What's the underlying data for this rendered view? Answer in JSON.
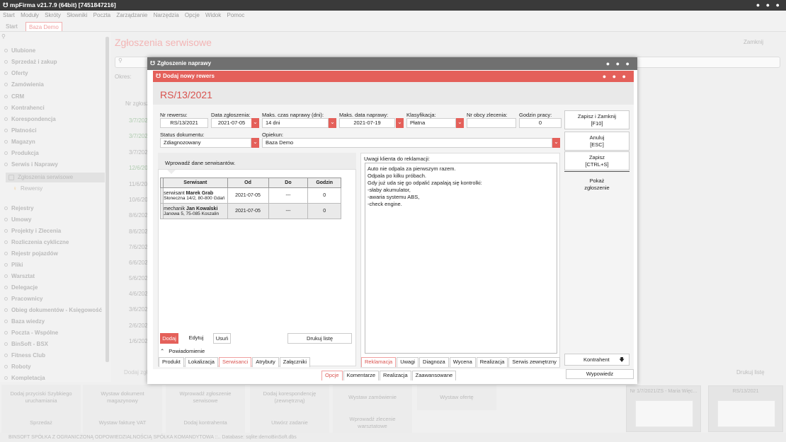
{
  "app": {
    "title": "mpFirma v21.7.9 (64bit) [7451847216]"
  },
  "menu": [
    "Start",
    "Moduły",
    "Skróty",
    "Słowniki",
    "Poczta",
    "Zarządzanie",
    "Narzędzia",
    "Opcje",
    "Widok",
    "Pomoc"
  ],
  "top_tabs": [
    "Start",
    "Baza Demo"
  ],
  "sidebar": {
    "items": [
      {
        "label": "Ulubione"
      },
      {
        "label": "Sprzedaż i zakup"
      },
      {
        "label": "Oferty"
      },
      {
        "label": "Zamówienia"
      },
      {
        "label": "CRM"
      },
      {
        "label": "Kontrahenci"
      },
      {
        "label": "Korespondencja"
      },
      {
        "label": "Płatności"
      },
      {
        "label": "Magazyn"
      },
      {
        "label": "Produkcja"
      },
      {
        "label": "Serwis i Naprawy"
      },
      {
        "label": "Zgłoszenia serwisowe"
      },
      {
        "label": "Rewersy"
      },
      {
        "label": "Rejestry"
      },
      {
        "label": "Umowy"
      },
      {
        "label": "Projekty i Zlecenia"
      },
      {
        "label": "Rozliczenia cykliczne"
      },
      {
        "label": "Rejestr pojazdów"
      },
      {
        "label": "Pliki"
      },
      {
        "label": "Warsztat"
      },
      {
        "label": "Delegacje"
      },
      {
        "label": "Pracownicy"
      },
      {
        "label": "Obieg dokumentów - Księgowość"
      },
      {
        "label": "Baza wiedzy"
      },
      {
        "label": "Poczta - Wspólne"
      },
      {
        "label": "BinSoft - BSX"
      },
      {
        "label": "Fitness Club"
      },
      {
        "label": "Roboty"
      },
      {
        "label": "Kompletacja"
      }
    ]
  },
  "background": {
    "title": "Zgłoszenia serwisowe",
    "close": "Zamknij",
    "okres": "Okres:",
    "col_nr": "Nr zgłosz",
    "dates": [
      "3/7/202",
      "3/7/202",
      "3/7/202",
      "12/6/202",
      "11/6/202",
      "10/6/202",
      "8/6/202",
      "8/6/202",
      "7/6/202",
      "6/6/202",
      "5/6/202",
      "4/6/202",
      "3/6/202",
      "2/6/202",
      "1/6/202"
    ],
    "dodaj": "Dodaj zgł",
    "drukuj": "Drukuj listę",
    "wypowiedz": "Wypowiedz"
  },
  "tiles": [
    "Dodaj przyciski Szybkiego uruchamiania",
    "Wystaw dokument magazynowy",
    "Wprowadź zgłoszenie serwisowe",
    "Dodaj korespondencję (zewnętrzną)",
    "Wystaw zamówienie",
    "Wystaw ofertę",
    "Sprzedaż",
    "Wystaw fakturę VAT",
    "Dodaj kontrahenta",
    "Utwórz zadanie",
    "Wprowadź zlecenie warsztatowe"
  ],
  "thumbs": [
    "Nr 1/7/2021/ZS - Maria Więc...",
    "RS/13/2021"
  ],
  "statusbar": "BINSOFT SPÓŁKA Z OGRANICZONĄ ODPOWIEDZIALNOŚCIĄ SPÓŁKA KOMANDYTOWA ::.. Database: sqlite:demoBinSoft.dbs",
  "dialog_outer": {
    "title": "Zgłoszenie naprawy",
    "tabs": [
      "Opcje",
      "Komentarze",
      "Realizacja",
      "Zaawansowane"
    ]
  },
  "dialog_inner": {
    "title": "Dodaj nowy rewers",
    "doc_number": "RS/13/2021",
    "fields": {
      "nr_rewersu_label": "Nr rewersu:",
      "nr_rewersu": "RS/13/2021",
      "data_label": "Data zgłoszenia:",
      "data": "2021-07-05",
      "maks_czas_label": "Maks. czas naprawy (dni):",
      "maks_czas": "14 dni",
      "maks_data_label": "Maks. data naprawy:",
      "maks_data": "2021-07-19",
      "klasyfikacja_label": "Klasyfikacja:",
      "klasyfikacja": "Płatna",
      "nr_obcy_label": "Nr obcy zlecenia:",
      "nr_obcy": "",
      "godzin_label": "Godzin pracy:",
      "godzin": "0",
      "status_label": "Status dokumentu:",
      "status": "Zdiagnozowany",
      "opiekun_label": "Opiekun:",
      "opiekun": "Baza Demo"
    },
    "side_buttons": {
      "save_close": "Zapisz i Zamknij",
      "save_close_key": "[F10]",
      "cancel": "Anuluj",
      "cancel_key": "[ESC]",
      "save": "Zapisz",
      "save_key": "[CTRL+S]",
      "show": "Pokaż",
      "show2": "zgłoszenie",
      "kontrahent": "Kontrahent"
    },
    "servicers_tab": "Wprowadź dane serwisantów.",
    "table": {
      "headers": [
        "Serwisant",
        "Od",
        "Do",
        "Godzin"
      ],
      "rows": [
        {
          "role": "serwisant",
          "name": "Marek Grab",
          "addr": "Słoneczna 14/2, 80-800 Gdań",
          "od": "2021-07-05",
          "do": "---",
          "godzin": "0"
        },
        {
          "role": "mechanik",
          "name": "Jan Kowalski",
          "addr": "Janowa 5, 75-085 Koszalin",
          "od": "2021-07-05",
          "do": "---",
          "godzin": "0"
        }
      ]
    },
    "left_buttons": {
      "dodaj": "Dodaj",
      "edytuj": "Edytuj",
      "usun": "Usuń",
      "drukuj": "Drukuj listę",
      "powiadomienie": "Powiadomienie"
    },
    "left_tabs": [
      "Produkt",
      "Lokalizacja",
      "Serwisanci",
      "Atrybuty",
      "Załączniki"
    ],
    "uwagi_label": "Uwagi klienta do reklamacji:",
    "uwagi_text": "Auto nie odpala za pierwszym razem.\nOdpala po kilku próbach.\nGdy już uda się go odpalić zapalają się kontrolki:\n-słaby akumulator,\n-awaria systemu ABS,\n-check engine.",
    "right_tabs": [
      "Reklamacja",
      "Uwagi",
      "Diagnoza",
      "Wycena",
      "Realizacja",
      "Serwis zewnętrzny"
    ]
  }
}
